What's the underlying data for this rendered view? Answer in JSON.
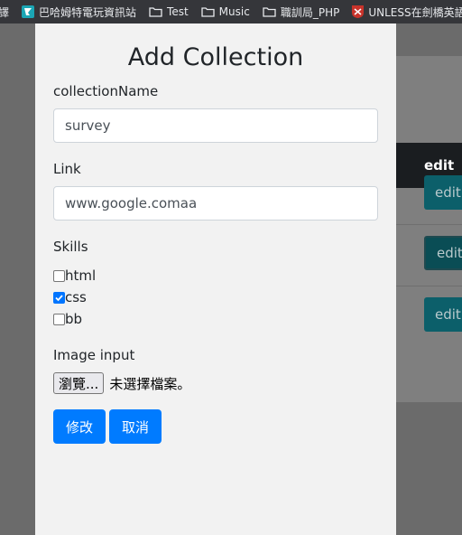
{
  "bookmarks": [
    {
      "label": "譯",
      "icon": "folder-icon"
    },
    {
      "label": "巴哈姆特電玩資訊站",
      "icon": "bahamut-icon"
    },
    {
      "label": "Test",
      "icon": "folder-icon"
    },
    {
      "label": "Music",
      "icon": "folder-icon"
    },
    {
      "label": "職訓局_PHP",
      "icon": "folder-icon"
    },
    {
      "label": "UNLESS在劍橋英語詞",
      "icon": "cambridge-icon"
    }
  ],
  "background_table": {
    "header": "edit",
    "row_buttons": [
      "edit",
      "edit",
      "edit"
    ]
  },
  "modal": {
    "title": "Add Collection",
    "collection_name": {
      "label": "collectionName",
      "value": "survey"
    },
    "link": {
      "label": "Link",
      "value": "www.google.comaa"
    },
    "skills": {
      "label": "Skills",
      "options": [
        {
          "label": "html",
          "checked": false
        },
        {
          "label": "css",
          "checked": true
        },
        {
          "label": "bb",
          "checked": false
        }
      ]
    },
    "image_input": {
      "label": "Image input",
      "browse_label": "瀏覽...",
      "status": "未選擇檔案。"
    },
    "buttons": {
      "submit": "修改",
      "cancel": "取消"
    }
  },
  "colors": {
    "primary": "#007bff",
    "checkbox_checked": "#0075ff",
    "backdrop": "#6b6b6b",
    "bookmarks_bar": "#35363a"
  }
}
